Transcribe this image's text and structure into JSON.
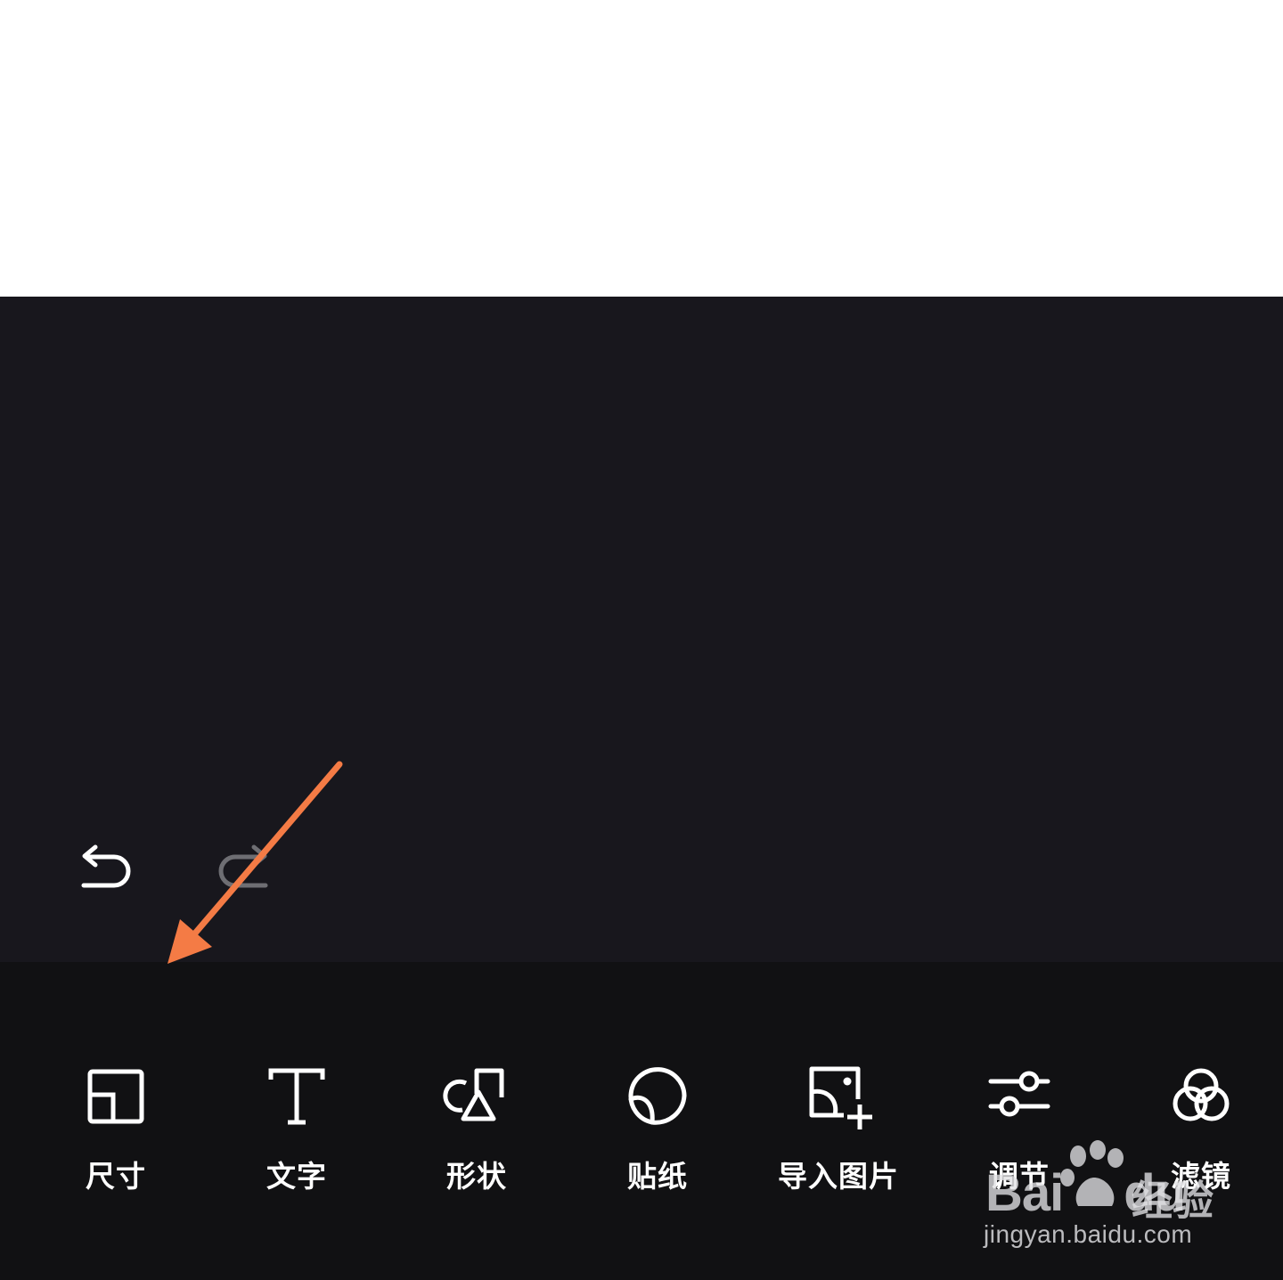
{
  "history": {
    "undo_icon": "undo-icon",
    "redo_icon": "redo-icon",
    "redo_enabled": false
  },
  "toolbar": {
    "items": [
      {
        "label": "尺寸",
        "icon": "size-icon"
      },
      {
        "label": "文字",
        "icon": "text-icon"
      },
      {
        "label": "形状",
        "icon": "shape-icon"
      },
      {
        "label": "贴纸",
        "icon": "sticker-icon"
      },
      {
        "label": "导入图片",
        "icon": "import-image-icon"
      },
      {
        "label": "调节",
        "icon": "adjust-icon"
      },
      {
        "label": "滤镜",
        "icon": "filter-icon"
      }
    ]
  },
  "annotation": {
    "arrow_color": "#f47b45"
  },
  "watermark": {
    "brand": "Bai",
    "brand_suffix": "du",
    "cn": "经验",
    "url": "jingyan.baidu.com"
  },
  "colors": {
    "canvas_bg": "#18171d",
    "toolbar_bg": "#111113",
    "icon": "#ffffff",
    "redo_disabled": "#6e6e73"
  }
}
